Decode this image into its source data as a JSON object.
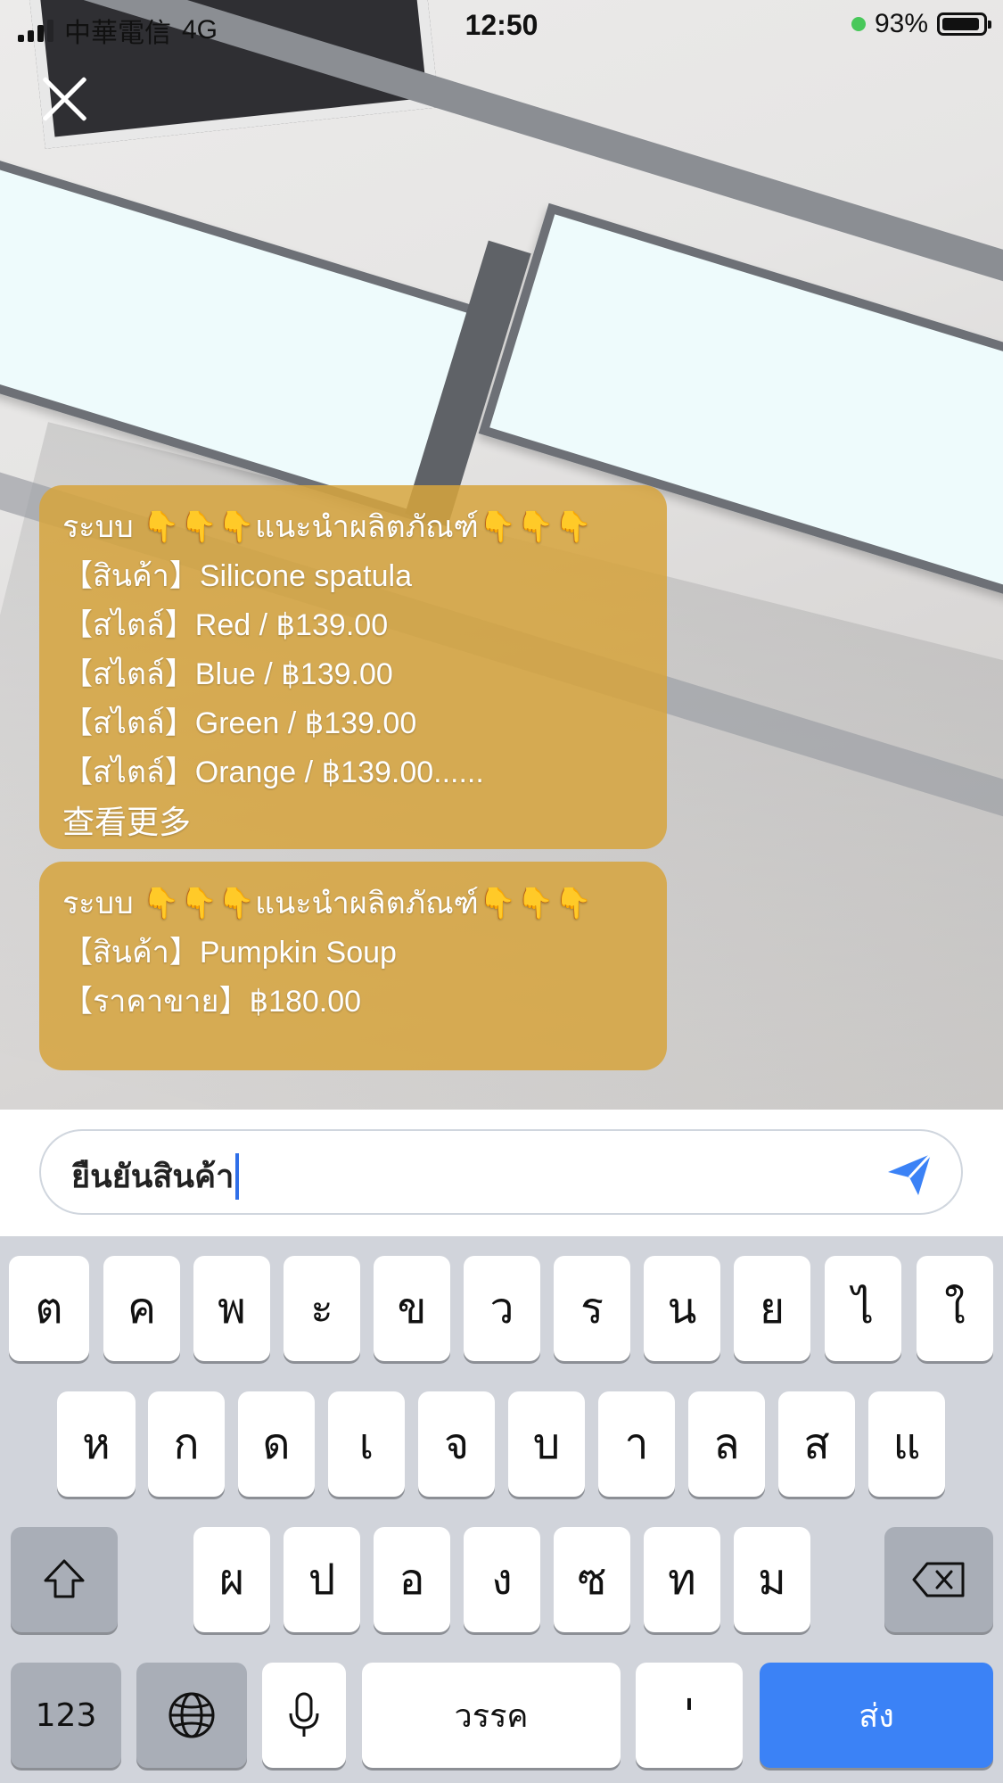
{
  "status_bar": {
    "carrier": "中華電信",
    "network": "4G",
    "time": "12:50",
    "battery": "93%",
    "battery_level": 0.93
  },
  "overlay": {
    "close_icon": "close-icon"
  },
  "messages": [
    {
      "lines": [
        "ระบบ 👇👇👇แนะนำผลิตภัณฑ์👇👇👇",
        "【สินค้า】Silicone spatula",
        "【สไตล์】Red / ฿139.00",
        "【สไตล์】Blue / ฿139.00",
        "【สไตล์】Green / ฿139.00",
        "【สไตล์】Orange / ฿139.00......"
      ],
      "more_label": "查看更多"
    },
    {
      "lines": [
        "ระบบ 👇👇👇แนะนำผลิตภัณฑ์👇👇👇",
        "【สินค้า】Pumpkin Soup",
        "【ราคาขาย】฿180.00"
      ]
    }
  ],
  "input": {
    "value": "ยืนยันสินค้า",
    "send_icon": "send-icon"
  },
  "keyboard": {
    "row1": [
      "ต",
      "ค",
      "พ",
      "ะ",
      "ข",
      "ว",
      "ร",
      "น",
      "ย",
      "ไ",
      "ใ"
    ],
    "row2": [
      "ห",
      "ก",
      "ด",
      "เ",
      "จ",
      "บ",
      "า",
      "ล",
      "ส",
      "แ"
    ],
    "row3": [
      "ผ",
      "ป",
      "อ",
      "ง",
      "ซ",
      "ท",
      "ม"
    ],
    "numbers_label": "123",
    "space_label": "วรรค",
    "apostrophe_label": "'",
    "send_label": "ส่ง",
    "colors": {
      "accent": "#3b82f6",
      "bubble": "#d6a43e"
    }
  }
}
